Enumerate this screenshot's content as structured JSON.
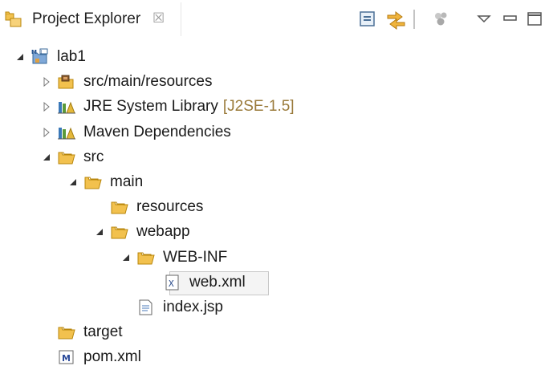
{
  "view": {
    "title": "Project Explorer",
    "close_glyph": "☒",
    "toolbar": {
      "icons": [
        "collapse-all-icon",
        "link-with-editor-icon",
        "filter-icon",
        "view-menu-icon",
        "minimize-icon",
        "maximize-icon"
      ]
    }
  },
  "tree": [
    {
      "label": "lab1",
      "icon": "maven-project-icon",
      "depth": 0,
      "expanded": true
    },
    {
      "label": "src/main/resources",
      "icon": "source-folder-icon",
      "depth": 1,
      "expanded": false
    },
    {
      "label": "JRE System Library",
      "decoration": "[J2SE-1.5]",
      "icon": "library-icon",
      "depth": 1,
      "expanded": false
    },
    {
      "label": "Maven Dependencies",
      "icon": "library-icon",
      "depth": 1,
      "expanded": false
    },
    {
      "label": "src",
      "icon": "folder-icon",
      "depth": 1,
      "expanded": true
    },
    {
      "label": "main",
      "icon": "folder-icon",
      "depth": 2,
      "expanded": true
    },
    {
      "label": "resources",
      "icon": "folder-icon",
      "depth": 3,
      "expanded": null
    },
    {
      "label": "webapp",
      "icon": "folder-icon",
      "depth": 3,
      "expanded": true
    },
    {
      "label": "WEB-INF",
      "icon": "folder-icon",
      "depth": 4,
      "expanded": true
    },
    {
      "label": "web.xml",
      "icon": "xml-file-icon",
      "depth": 5,
      "expanded": null,
      "selected": true
    },
    {
      "label": "index.jsp",
      "icon": "jsp-file-icon",
      "depth": 4,
      "expanded": null
    },
    {
      "label": "target",
      "icon": "folder-icon",
      "depth": 1,
      "expanded": null
    },
    {
      "label": "pom.xml",
      "icon": "maven-pom-icon",
      "depth": 1,
      "expanded": null
    }
  ],
  "colors": {
    "folder": "#f2c14e",
    "folder_stroke": "#b8860b",
    "decoration": "#9a7a3a",
    "selection_border": "#c7c7c7"
  }
}
